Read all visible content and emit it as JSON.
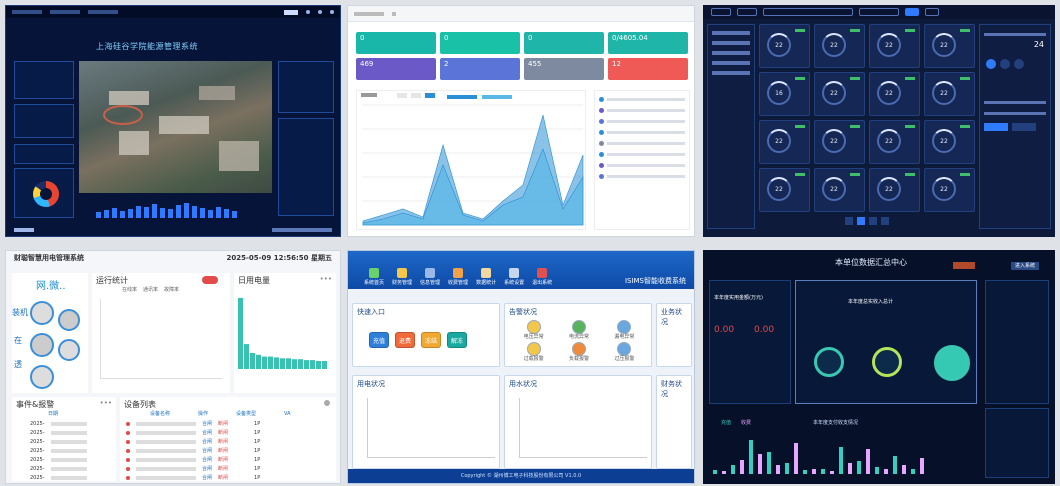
{
  "panel1": {
    "title": "上海硅谷学院能源管理系统"
  },
  "panel2": {
    "kpis": [
      {
        "value": "0",
        "color": "#18b7a9"
      },
      {
        "value": "0",
        "color": "#19c2a7"
      },
      {
        "value": "0",
        "color": "#1fb6a9"
      },
      {
        "value": "0/4605.04",
        "color": "#1fb6a9"
      },
      {
        "value": "469",
        "color": "#6a59c7"
      },
      {
        "value": "2",
        "color": "#5a74d8"
      },
      {
        "value": "455",
        "color": "#7d8aa0"
      },
      {
        "value": "12",
        "color": "#ef5a56"
      }
    ],
    "chart_data": {
      "type": "area",
      "series": [
        {
          "values": [
            2,
            5,
            8,
            4,
            40,
            6,
            3,
            12,
            20,
            55,
            10,
            35
          ]
        },
        {
          "values": [
            1,
            3,
            6,
            3,
            30,
            5,
            2,
            10,
            14,
            38,
            8,
            24
          ]
        }
      ],
      "ylim": [
        0,
        60
      ]
    }
  },
  "panel3": {
    "card_values": [
      "22",
      "22",
      "22",
      "22",
      "16",
      "22",
      "22",
      "22",
      "22",
      "22",
      "22",
      "22",
      "22",
      "22",
      "22",
      "22"
    ]
  },
  "panel4": {
    "title": "财聪智慧用电管理系统",
    "datetime": "2025-05-09 12:56:50 星期五",
    "tabs": {
      "run": "运行统计",
      "daily": "日用电量",
      "events": "事件&报警",
      "devices": "设备列表"
    },
    "logo_text": "网.微..",
    "side_labels": [
      "装机",
      "在",
      "透"
    ],
    "legend": [
      "在线率",
      "通讯率",
      "故障率"
    ],
    "table_cols": [
      "设备名称",
      "操作",
      "设备类型",
      "VA"
    ],
    "event_rows": [
      "2025-",
      "2025-",
      "2025-",
      "2025-",
      "2025-",
      "2025-",
      "2025-"
    ],
    "device_rows": [
      "1P",
      "1P",
      "1P",
      "1P",
      "1P",
      "1P",
      "1P"
    ],
    "actions": {
      "open": "合闸",
      "close": "断闸"
    },
    "date_col": "日期",
    "more": "•••",
    "daily_values": [
      80,
      28,
      18,
      16,
      14,
      14,
      13,
      12,
      12,
      11,
      11,
      10,
      10,
      9,
      9
    ],
    "daily_ylim": [
      0,
      90
    ]
  },
  "panel5": {
    "brand": "ISIMS智能收费系统",
    "nav": [
      {
        "label": "系统首页",
        "color": "#6bd26b"
      },
      {
        "label": "财务管理",
        "color": "#f3c74a"
      },
      {
        "label": "信息管理",
        "color": "#9ab8e8"
      },
      {
        "label": "收费管理",
        "color": "#f3a24a"
      },
      {
        "label": "数据统计",
        "color": "#f2d8a0"
      },
      {
        "label": "系统设置",
        "color": "#c7d7f0"
      },
      {
        "label": "退出系统",
        "color": "#e05050"
      }
    ],
    "quick_title": "快速入口",
    "quick": [
      {
        "label": "充值",
        "color": "#2e7fd9"
      },
      {
        "label": "退费",
        "color": "#f06a3a"
      },
      {
        "label": "冻结",
        "color": "#f2a934"
      },
      {
        "label": "解冻",
        "color": "#19a9a0"
      }
    ],
    "alarm_title": "告警状况",
    "alarms": [
      "电压异常",
      "电流异常",
      "漏电异常",
      "过载报警",
      "负载报警",
      "过压报警"
    ],
    "usage_title": "用电状况",
    "water_title": "用水状况",
    "biz_title": "业务状况",
    "finance_title": "财务状况",
    "footer": "Copyright © 湖州博工电子科技股份有限公司 V1.0.0"
  },
  "panel6": {
    "title": "本单位数据汇总中心",
    "tab_active": "进入系统",
    "money_title": "本年度实用金额(万元)",
    "income_title": "本年度总实收入总计",
    "zero1": "0.00",
    "zero2": "0.00",
    "bar_title": "本年度支付收支情况",
    "chart_data": {
      "type": "bar",
      "series": [
        {
          "values": [
            5,
            10,
            38,
            24,
            12,
            4,
            6,
            30,
            14,
            8,
            20,
            6
          ],
          "color": "#33d0c2"
        },
        {
          "values": [
            3,
            16,
            22,
            10,
            34,
            6,
            3,
            12,
            28,
            6,
            10,
            18
          ],
          "color": "#e7a7ff"
        }
      ],
      "ylim": [
        0,
        40
      ]
    },
    "legend": [
      "充值",
      "收费"
    ]
  }
}
